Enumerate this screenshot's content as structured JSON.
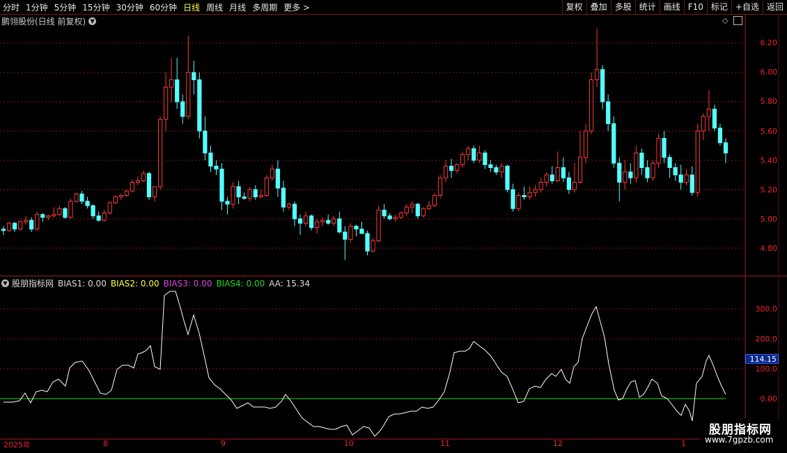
{
  "toolbar": {
    "periods": [
      "分时",
      "1分钟",
      "5分钟",
      "15分钟",
      "30分钟",
      "60分钟",
      "日线",
      "周线",
      "月线",
      "多周期",
      "更多 >"
    ],
    "active_period": "日线",
    "buttons": [
      "复权",
      "叠加",
      "多股",
      "统计",
      "画线",
      "F10",
      "标记",
      "+自选",
      "返回"
    ]
  },
  "stock": {
    "title": "鹏翎股份(日线 前复权)",
    "dropdown_icon": "chevron-down-icon"
  },
  "price_axis": [
    "6.20",
    "6.00",
    "5.80",
    "5.60",
    "5.40",
    "5.20",
    "5.00",
    "4.80"
  ],
  "indicator": {
    "name": "股朋指标网",
    "bias1_label": "BIAS1: 0.00",
    "bias2_label": "BIAS2: 0.00",
    "bias3_label": "BIAS3: 0.00",
    "bias4_label": "BIAS4: 0.00",
    "aa_label": "AA: 15.34",
    "axis": [
      "300.0",
      "200.0",
      "100.0",
      "0.00"
    ],
    "current_value": "114.15"
  },
  "dates": [
    "2025年",
    "8",
    "9",
    "10",
    "11",
    "12",
    "1"
  ],
  "watermark": {
    "title": "股朋指标网",
    "url": "www.7gpzb.com"
  },
  "colors": {
    "up": "#ff3b3b",
    "down": "#54ffff",
    "grid": "#8a1818",
    "line": "#ffffff",
    "zero_line": "#22dd22",
    "bias1": "#dddddd",
    "bias2": "#ffff44",
    "bias3": "#dd44dd",
    "bias4": "#22dd22"
  },
  "chart_data": {
    "type": "candlestick",
    "price_range": [
      4.7,
      6.3
    ],
    "candles": [
      [
        4.93,
        4.95,
        4.89,
        4.92
      ],
      [
        4.92,
        4.98,
        4.91,
        4.97
      ],
      [
        4.97,
        4.98,
        4.91,
        4.93
      ],
      [
        4.93,
        4.99,
        4.92,
        4.98
      ],
      [
        4.98,
        5.02,
        4.96,
        4.99
      ],
      [
        4.99,
        5.01,
        4.91,
        4.93
      ],
      [
        4.93,
        5.05,
        4.92,
        5.03
      ],
      [
        5.03,
        5.04,
        4.98,
        5.01
      ],
      [
        5.01,
        5.03,
        4.99,
        5.02
      ],
      [
        5.02,
        5.08,
        5.01,
        5.03
      ],
      [
        5.03,
        5.09,
        5.02,
        5.07
      ],
      [
        5.07,
        5.08,
        5.0,
        5.01
      ],
      [
        5.01,
        5.14,
        5.0,
        5.12
      ],
      [
        5.12,
        5.18,
        5.11,
        5.17
      ],
      [
        5.17,
        5.19,
        5.1,
        5.12
      ],
      [
        5.12,
        5.15,
        5.07,
        5.09
      ],
      [
        5.09,
        5.1,
        5.0,
        5.02
      ],
      [
        5.02,
        5.05,
        4.98,
        4.99
      ],
      [
        4.99,
        5.06,
        4.98,
        5.04
      ],
      [
        5.04,
        5.12,
        5.03,
        5.11
      ],
      [
        5.11,
        5.16,
        5.1,
        5.15
      ],
      [
        5.15,
        5.17,
        5.13,
        5.16
      ],
      [
        5.16,
        5.2,
        5.15,
        5.19
      ],
      [
        5.19,
        5.27,
        5.18,
        5.25
      ],
      [
        5.25,
        5.29,
        5.23,
        5.26
      ],
      [
        5.26,
        5.33,
        5.25,
        5.31
      ],
      [
        5.31,
        5.32,
        5.13,
        5.15
      ],
      [
        5.15,
        5.18,
        5.12,
        5.22
      ],
      [
        5.22,
        5.7,
        5.2,
        5.68
      ],
      [
        5.68,
        6.0,
        5.6,
        5.9
      ],
      [
        5.9,
        6.1,
        5.8,
        5.95
      ],
      [
        5.95,
        6.1,
        5.75,
        5.8
      ],
      [
        5.8,
        5.85,
        5.65,
        5.7
      ],
      [
        5.7,
        6.25,
        5.68,
        6.0
      ],
      [
        6.0,
        6.08,
        5.85,
        5.95
      ],
      [
        5.95,
        6.0,
        5.55,
        5.6
      ],
      [
        5.6,
        5.7,
        5.4,
        5.45
      ],
      [
        5.45,
        5.5,
        5.32,
        5.36
      ],
      [
        5.36,
        5.4,
        5.3,
        5.34
      ],
      [
        5.34,
        5.38,
        5.06,
        5.12
      ],
      [
        5.12,
        5.15,
        5.03,
        5.1
      ],
      [
        5.1,
        5.25,
        5.07,
        5.22
      ],
      [
        5.22,
        5.26,
        5.1,
        5.15
      ],
      [
        5.15,
        5.18,
        5.13,
        5.14
      ],
      [
        5.14,
        5.22,
        5.12,
        5.2
      ],
      [
        5.2,
        5.23,
        5.13,
        5.15
      ],
      [
        5.15,
        5.2,
        5.14,
        5.16
      ],
      [
        5.16,
        5.3,
        5.15,
        5.28
      ],
      [
        5.28,
        5.37,
        5.26,
        5.34
      ],
      [
        5.34,
        5.4,
        5.15,
        5.21
      ],
      [
        5.21,
        5.26,
        5.05,
        5.08
      ],
      [
        5.08,
        5.11,
        5.06,
        5.1
      ],
      [
        5.1,
        5.12,
        4.95,
        5.0
      ],
      [
        5.0,
        5.03,
        4.89,
        4.97
      ],
      [
        4.97,
        5.05,
        4.95,
        5.02
      ],
      [
        5.02,
        5.03,
        4.92,
        4.94
      ],
      [
        4.94,
        5.0,
        4.9,
        4.98
      ],
      [
        4.98,
        5.01,
        4.95,
        4.99
      ],
      [
        4.99,
        5.03,
        4.96,
        4.97
      ],
      [
        4.97,
        5.02,
        4.95,
        5.0
      ],
      [
        5.0,
        5.05,
        4.9,
        4.91
      ],
      [
        4.91,
        4.95,
        4.72,
        4.86
      ],
      [
        4.86,
        4.97,
        4.84,
        4.95
      ],
      [
        4.95,
        4.96,
        4.88,
        4.93
      ],
      [
        4.93,
        4.98,
        4.92,
        4.9
      ],
      [
        4.9,
        4.92,
        4.75,
        4.78
      ],
      [
        4.78,
        4.87,
        4.77,
        4.85
      ],
      [
        4.85,
        5.09,
        4.84,
        5.06
      ],
      [
        5.06,
        5.1,
        5.0,
        5.02
      ],
      [
        5.02,
        5.04,
        4.99,
        5.0
      ],
      [
        5.0,
        5.03,
        4.98,
        5.01
      ],
      [
        5.01,
        5.05,
        5.0,
        5.04
      ],
      [
        5.04,
        5.1,
        5.02,
        5.08
      ],
      [
        5.08,
        5.12,
        5.04,
        5.1
      ],
      [
        5.1,
        5.11,
        5.0,
        5.02
      ],
      [
        5.02,
        5.08,
        5.01,
        5.07
      ],
      [
        5.07,
        5.12,
        5.06,
        5.09
      ],
      [
        5.09,
        5.18,
        5.08,
        5.16
      ],
      [
        5.16,
        5.3,
        5.14,
        5.28
      ],
      [
        5.28,
        5.4,
        5.25,
        5.36
      ],
      [
        5.36,
        5.41,
        5.28,
        5.33
      ],
      [
        5.33,
        5.38,
        5.31,
        5.37
      ],
      [
        5.37,
        5.46,
        5.35,
        5.44
      ],
      [
        5.44,
        5.5,
        5.4,
        5.48
      ],
      [
        5.48,
        5.5,
        5.38,
        5.4
      ],
      [
        5.4,
        5.5,
        5.38,
        5.45
      ],
      [
        5.45,
        5.47,
        5.34,
        5.37
      ],
      [
        5.37,
        5.4,
        5.32,
        5.35
      ],
      [
        5.35,
        5.37,
        5.3,
        5.32
      ],
      [
        5.32,
        5.38,
        5.28,
        5.36
      ],
      [
        5.36,
        5.37,
        5.18,
        5.2
      ],
      [
        5.2,
        5.24,
        5.05,
        5.07
      ],
      [
        5.07,
        5.18,
        5.05,
        5.16
      ],
      [
        5.16,
        5.22,
        5.13,
        5.15
      ],
      [
        5.15,
        5.22,
        5.13,
        5.18
      ],
      [
        5.18,
        5.23,
        5.15,
        5.2
      ],
      [
        5.2,
        5.28,
        5.18,
        5.25
      ],
      [
        5.25,
        5.32,
        5.22,
        5.3
      ],
      [
        5.3,
        5.36,
        5.24,
        5.26
      ],
      [
        5.26,
        5.46,
        5.25,
        5.35
      ],
      [
        5.35,
        5.42,
        5.25,
        5.28
      ],
      [
        5.28,
        5.32,
        5.17,
        5.2
      ],
      [
        5.2,
        5.38,
        5.18,
        5.25
      ],
      [
        5.25,
        5.6,
        5.24,
        5.42
      ],
      [
        5.42,
        5.65,
        5.38,
        5.6
      ],
      [
        5.6,
        6.0,
        5.58,
        5.95
      ],
      [
        5.95,
        6.3,
        5.9,
        6.02
      ],
      [
        6.02,
        6.05,
        5.75,
        5.8
      ],
      [
        5.8,
        5.85,
        5.6,
        5.65
      ],
      [
        5.65,
        5.7,
        5.35,
        5.38
      ],
      [
        5.38,
        5.42,
        5.12,
        5.25
      ],
      [
        5.25,
        5.4,
        5.2,
        5.32
      ],
      [
        5.32,
        5.38,
        5.24,
        5.28
      ],
      [
        5.28,
        5.5,
        5.25,
        5.45
      ],
      [
        5.45,
        5.48,
        5.3,
        5.35
      ],
      [
        5.35,
        5.4,
        5.25,
        5.28
      ],
      [
        5.28,
        5.4,
        5.26,
        5.38
      ],
      [
        5.38,
        5.58,
        5.35,
        5.55
      ],
      [
        5.55,
        5.6,
        5.38,
        5.42
      ],
      [
        5.42,
        5.44,
        5.28,
        5.35
      ],
      [
        5.35,
        5.38,
        5.26,
        5.3
      ],
      [
        5.3,
        5.37,
        5.2,
        5.25
      ],
      [
        5.25,
        5.34,
        5.23,
        5.3
      ],
      [
        5.3,
        5.36,
        5.16,
        5.18
      ],
      [
        5.18,
        5.65,
        5.15,
        5.6
      ],
      [
        5.6,
        5.72,
        5.54,
        5.7
      ],
      [
        5.7,
        5.88,
        5.6,
        5.75
      ],
      [
        5.75,
        5.78,
        5.6,
        5.62
      ],
      [
        5.62,
        5.65,
        5.5,
        5.52
      ],
      [
        5.52,
        5.55,
        5.38,
        5.45
      ]
    ]
  }
}
